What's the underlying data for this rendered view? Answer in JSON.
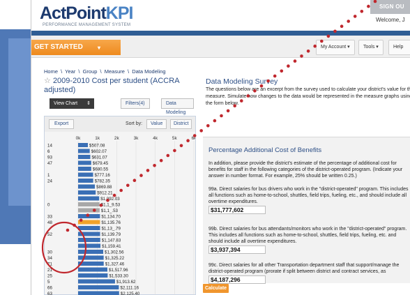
{
  "app": {
    "logo_main": "ActPoint",
    "logo_kpi": "KPI",
    "logo_subtitle": "PERFORMANCE MANAGEMENT SYSTEM",
    "signout": "SIGN OU",
    "welcome": "Welcome, J"
  },
  "toolbar": {
    "get_started": "GET STARTED",
    "get_started_caret": "▾",
    "my_account": "My Account ▾",
    "tools": "Tools ▾",
    "help": "Help"
  },
  "breadcrumb": [
    "Home",
    "Year",
    "Group",
    "Measure",
    "Data Modeling"
  ],
  "breadcrumb_sep": "\\",
  "measure": {
    "star": "☆",
    "title": "2009-2010 Cost per student (ACCRA adjusted)"
  },
  "chart_controls": {
    "view_chart": "View Chart",
    "view_chart_arrow": "⇕",
    "filters": "Filters(4)",
    "data_modeling": "Data Modeling",
    "export": "Export",
    "sort_by": "Sort by:",
    "sort_value": "Value",
    "sort_district": "District"
  },
  "data_modeling": {
    "title": "Data Modeling Survey",
    "description": "The questions below are an excerpt from the survey used to calculate your district's value for this measure. Simulate how changes to the data would be represented in the measure graphs using the form below."
  },
  "survey": {
    "heading": "Percentage Additional Cost of Benefits",
    "intro": "In addition, please provide the district's estimate of the percentage of additional cost for benefits for staff in the following categories of the district-operated program. (Indicate your answer in number format. For example, 25% should be written 0.25.)",
    "questions": [
      {
        "text": "99a. Direct salaries for bus drivers who work in the \"district-operated\" program. This includes all functions such as home-to-school, shuttles, field trips, fueling, etc., and should include all overtime expenditures.",
        "value": "$31,777,602"
      },
      {
        "text": "99b. Direct salaries for bus attendants/monitors who work in the \"district-operated\" program. This includes all functions such as home-to-school, shuttles, field trips, fueling, etc. and should include all overtime expenditures.",
        "value": "$3,937,394"
      },
      {
        "text": "99c. Direct salaries for all other Transportation department staff that support/manage the district-operated program (prorate if split between district and contract services, as necessary).",
        "value": "$4,187,296"
      }
    ],
    "calculate": "Calculate"
  },
  "chart_data": {
    "type": "bar",
    "orientation": "horizontal",
    "x_ticks": [
      "0k",
      "1k",
      "2k",
      "3k",
      "4k",
      "5k",
      "6k"
    ],
    "xlim": [
      0,
      6000
    ],
    "categories": [
      "14",
      "6",
      "93",
      "47",
      "",
      "1",
      "24",
      "",
      "",
      "",
      "0",
      "",
      "33",
      "48",
      "",
      "52",
      "",
      "",
      "30",
      "34",
      "71",
      "21",
      "25",
      "5",
      "66",
      "63"
    ],
    "values": [
      507.08,
      602.07,
      631.07,
      679.45,
      680.55,
      777.16,
      782.35,
      869.88,
      912.21,
      1092.03,
      1109.53,
      1117.53,
      1134.7,
      1135.76,
      1136.79,
      1139.79,
      1147.83,
      1159.41,
      1302.56,
      1325.22,
      1327.46,
      1517.96,
      1533.3,
      1913.62,
      2111.16,
      2125.4
    ],
    "labels": [
      "$507.08",
      "$602.07",
      "$631.07",
      "$679.45",
      "$680.55",
      "$777.16",
      "$782.35",
      "$869.88",
      "$912.21",
      "$1,092.03",
      "$1,1_9.53",
      "$1,1_.53",
      "$1,134.70",
      "$1,135.76",
      "$1,13_.79",
      "$1,139.79",
      "$1,147.83",
      "$1,159.41",
      "$1,302.56",
      "$1,325.22",
      "$1,327.46",
      "$1,517.96",
      "$1,533.30",
      "$1,913.62",
      "$2,111.16",
      "$2,125.40"
    ],
    "highlight": {
      "index": 13,
      "color": "#f0a32c"
    },
    "gray_indices": [
      10,
      11
    ],
    "bar_color": "#3a6fb5",
    "gray_color": "#a8a8a8"
  },
  "overlay_colors": {
    "dots": "#c0272d",
    "circle": "#c0272d"
  }
}
